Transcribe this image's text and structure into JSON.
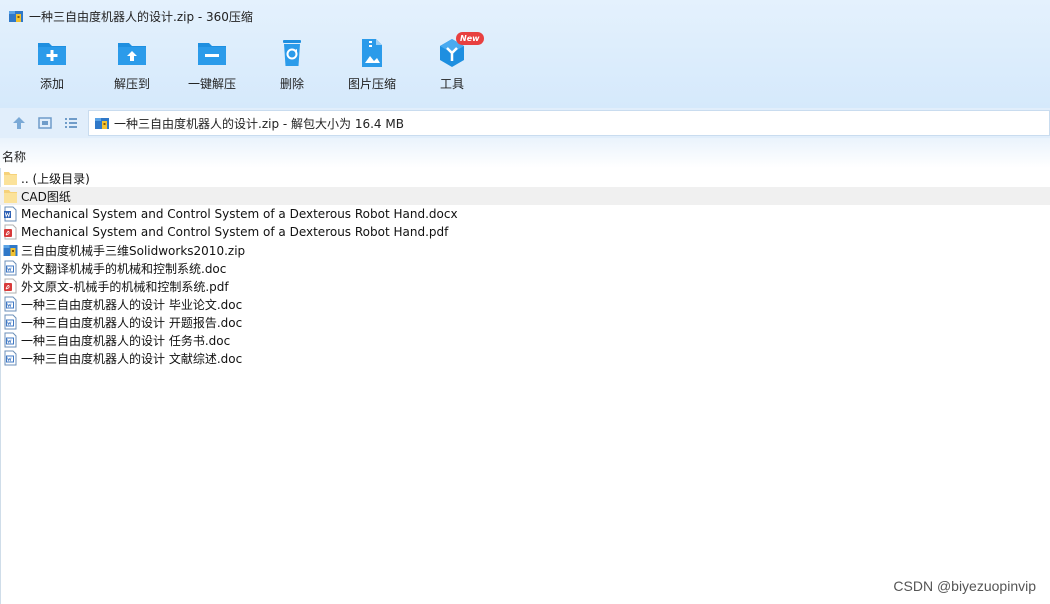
{
  "window": {
    "title": "一种三自由度机器人的设计.zip - 360压缩"
  },
  "toolbar": {
    "add": "添加",
    "extract_to": "解压到",
    "one_click_extract": "一键解压",
    "delete": "删除",
    "image_compress": "图片压缩",
    "tools": "工具",
    "new_badge": "New"
  },
  "address": {
    "path": "一种三自由度机器人的设计.zip - 解包大小为 16.4 MB"
  },
  "list": {
    "column_name": "名称",
    "items": [
      {
        "name": ".. (上级目录)",
        "icon": "folder-icon"
      },
      {
        "name": "CAD图纸",
        "icon": "folder-icon"
      },
      {
        "name": "Mechanical System and Control System of a Dexterous Robot Hand.docx",
        "icon": "word-doc-icon"
      },
      {
        "name": "Mechanical System and Control System of a Dexterous Robot Hand.pdf",
        "icon": "pdf-icon"
      },
      {
        "name": "三自由度机械手三维Solidworks2010.zip",
        "icon": "zip-icon"
      },
      {
        "name": "外文翻译机械手的机械和控制系统.doc",
        "icon": "doc-icon"
      },
      {
        "name": "外文原文-机械手的机械和控制系统.pdf",
        "icon": "pdf-icon"
      },
      {
        "name": "一种三自由度机器人的设计 毕业论文.doc",
        "icon": "doc-icon"
      },
      {
        "name": "一种三自由度机器人的设计 开题报告.doc",
        "icon": "doc-icon"
      },
      {
        "name": "一种三自由度机器人的设计 任务书.doc",
        "icon": "doc-icon"
      },
      {
        "name": "一种三自由度机器人的设计 文献综述.doc",
        "icon": "doc-icon"
      }
    ]
  },
  "watermark": "CSDN @biyezuopinvip",
  "colors": {
    "accent": "#1e8fe0",
    "toolbar_bg": "#d9ebfc",
    "selected_row": "#f0f0f0"
  }
}
